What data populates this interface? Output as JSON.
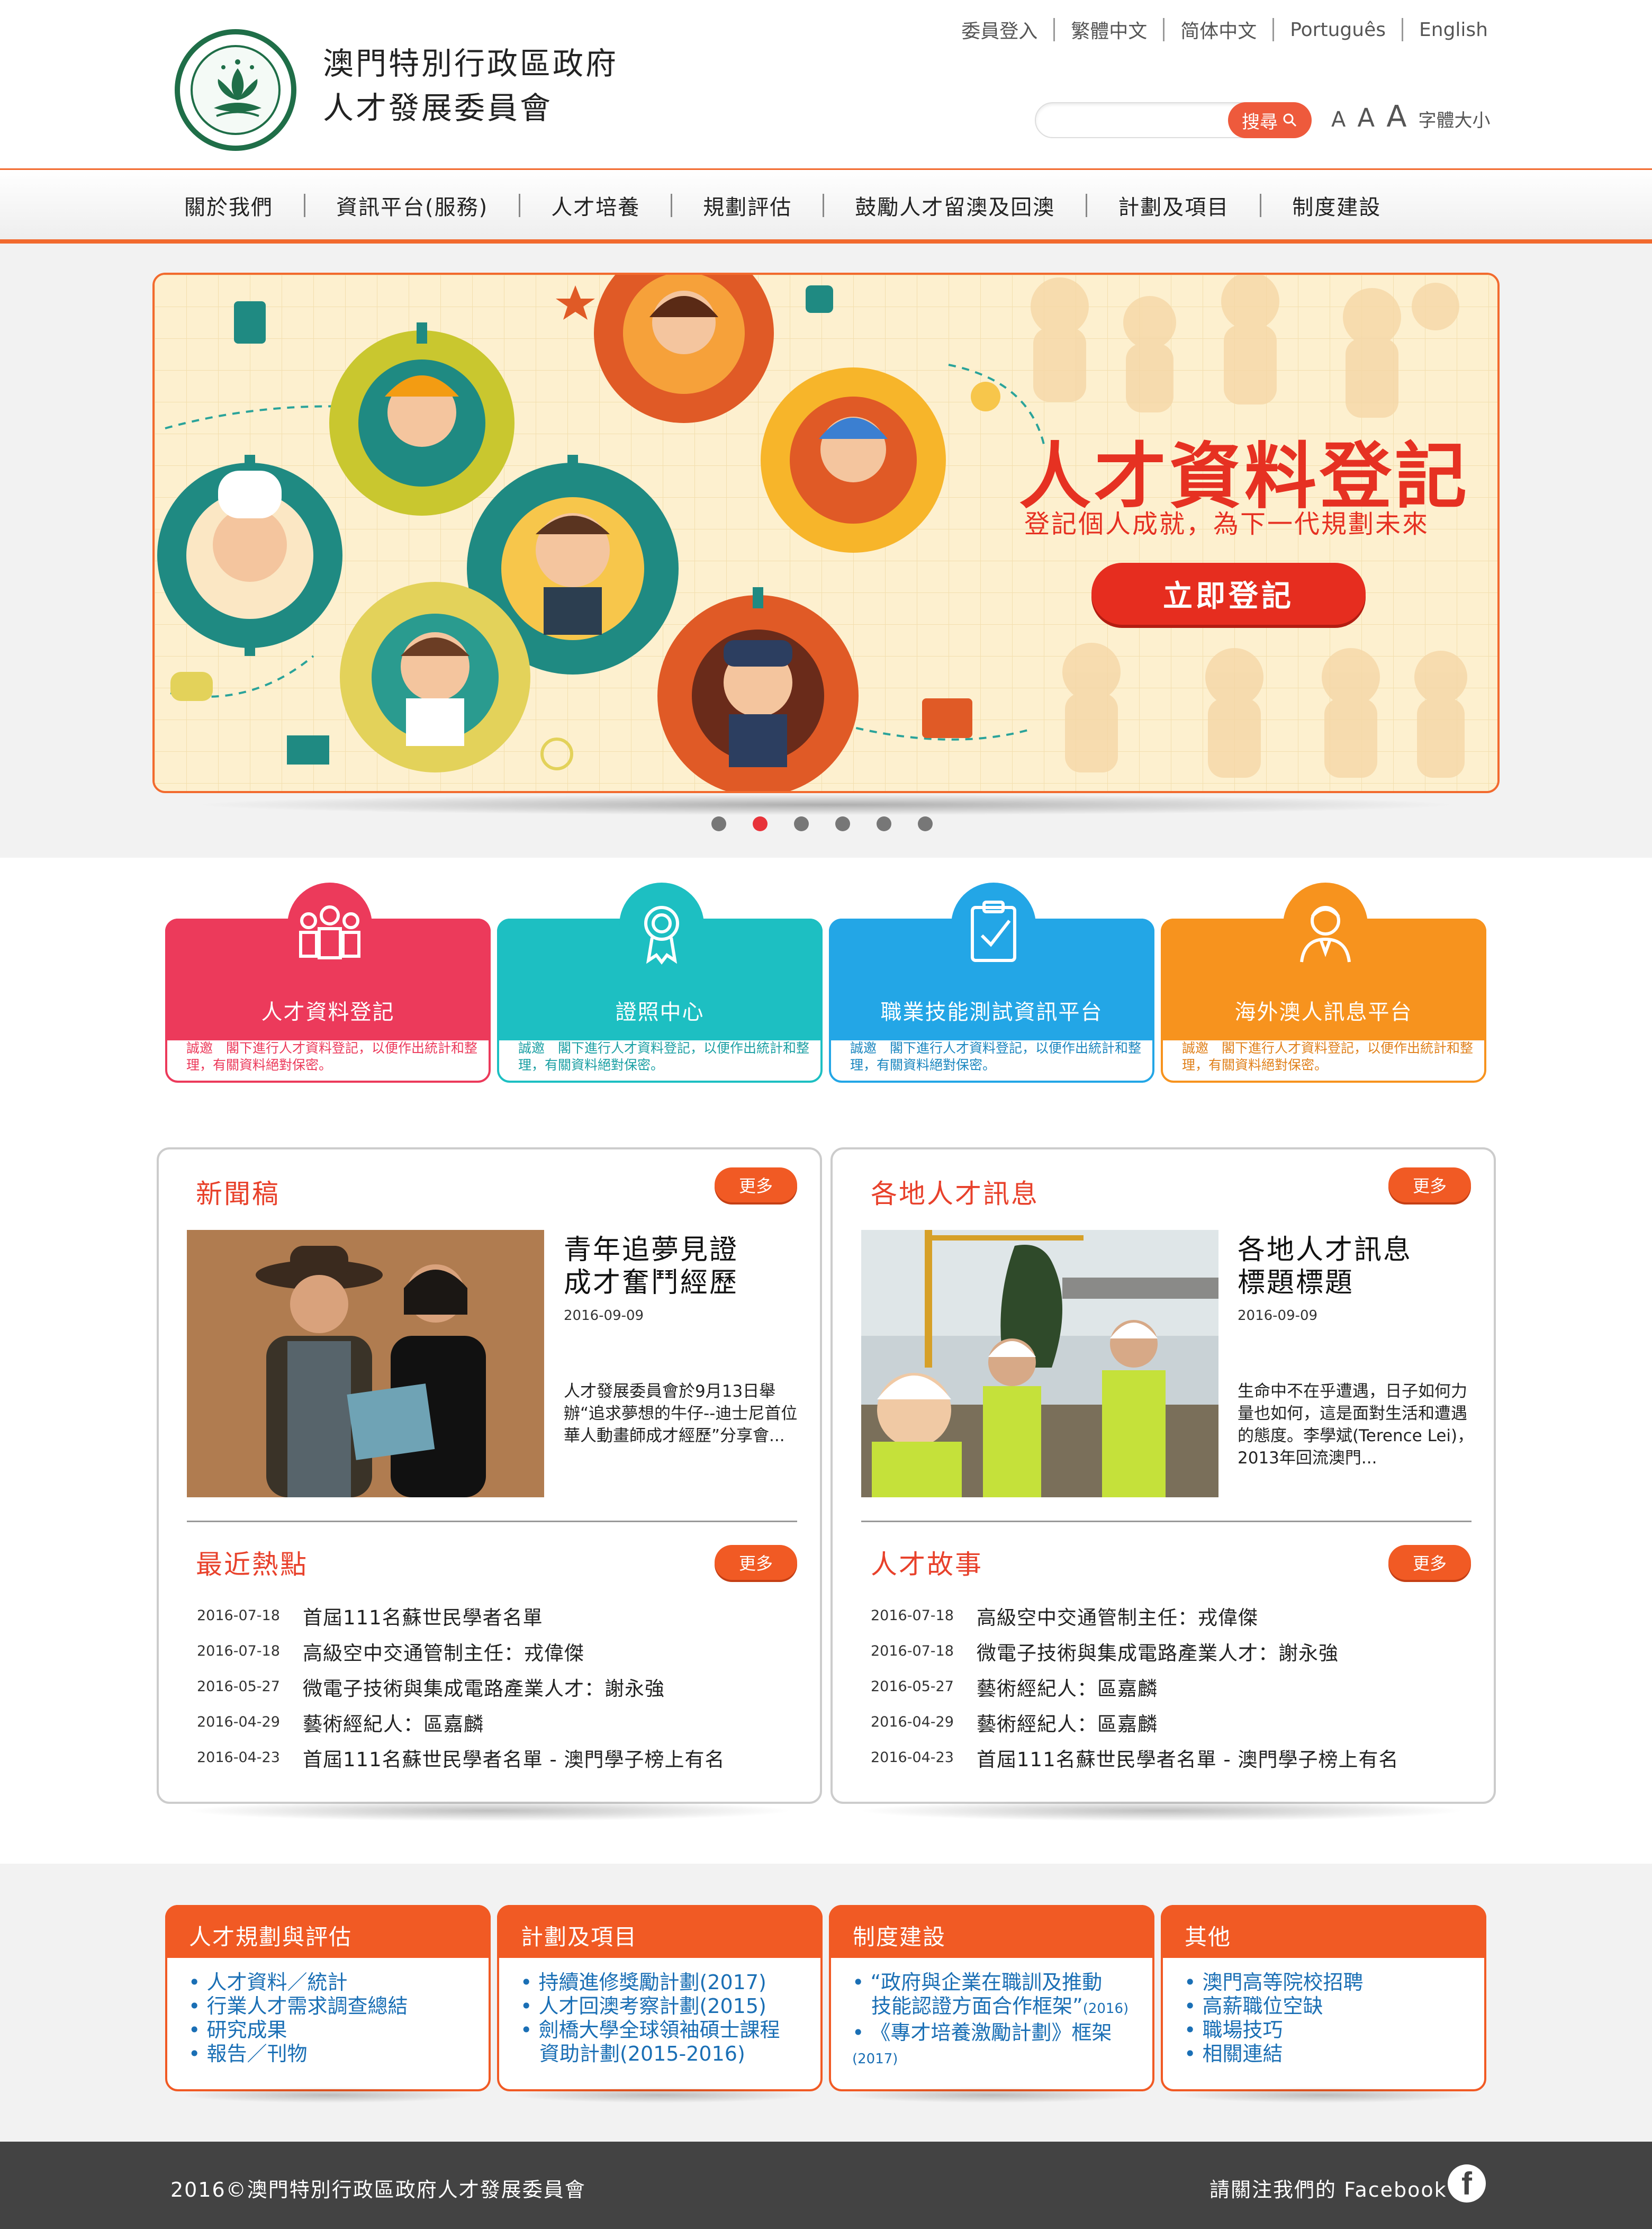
{
  "header": {
    "title_line1": "澳門特別行政區政府",
    "title_line2": "人才發展委員會",
    "top_links": [
      "委員登入",
      "繁體中文",
      "简体中文",
      "Português",
      "English"
    ],
    "search": {
      "button_label": "搜尋",
      "placeholder": ""
    },
    "font_size": {
      "small": "A",
      "medium": "A",
      "large": "A",
      "label": "字體大小"
    }
  },
  "nav": {
    "items": [
      "關於我們",
      "資訊平台(服務)",
      "人才培養",
      "規劃評估",
      "鼓勵人才留澳及回澳",
      "計劃及項目",
      "制度建設"
    ]
  },
  "banner": {
    "title": "人才資料登記",
    "subtitle": "登記個人成就，為下一代規劃未來",
    "button_label": "立即登記",
    "slide_count": 6,
    "active_slide": 2
  },
  "feature_cards": [
    {
      "label": "人才資料登記",
      "desc": "誠邀　閣下進行人才資料登記，以便作出統計和整理，有關資料絕對保密。",
      "color": "#ec3a5b",
      "icon": "people-icon"
    },
    {
      "label": "證照中心",
      "desc": "誠邀　閣下進行人才資料登記，以便作出統計和整理，有關資料絕對保密。",
      "color": "#1dbfc2",
      "icon": "certificate-icon"
    },
    {
      "label": "職業技能測試資訊平台",
      "desc": "誠邀　閣下進行人才資料登記，以便作出統計和整理，有關資料絕對保密。",
      "color": "#23a6e6",
      "icon": "clipboard-check-icon"
    },
    {
      "label": "海外澳人訊息平台",
      "desc": "誠邀　閣下進行人才資料登記，以便作出統計和整理，有關資料絕對保密。",
      "color": "#f7931e",
      "icon": "person-icon"
    }
  ],
  "news": {
    "title": "新聞稿",
    "more": "更多",
    "article": {
      "title_line1": "青年追夢見證",
      "title_line2": "成才奮鬥經歷",
      "date": "2016-09-09",
      "body": "人才發展委員會於9月13日舉辦“追求夢想的牛仔--迪士尼首位華人動畫師成才經歷”分享會..."
    }
  },
  "talent_info": {
    "title": "各地人才訊息",
    "more": "更多",
    "article": {
      "title_line1": "各地人才訊息",
      "title_line2": "標題標題",
      "date": "2016-09-09",
      "body": "生命中不在乎遭遇，日子如何力量也如何，這是面對生活和遭遇的態度。李學斌(Terence Lei)，2013年回流澳門..."
    }
  },
  "hot_topics": {
    "title": "最近熱點",
    "more": "更多",
    "items": [
      {
        "date": "2016-07-18",
        "text": "首屆111名蘇世民學者名單"
      },
      {
        "date": "2016-07-18",
        "text": "高級空中交通管制主任：戎偉傑"
      },
      {
        "date": "2016-05-27",
        "text": "微電子技術與集成電路產業人才：謝永強"
      },
      {
        "date": "2016-04-29",
        "text": "藝術經紀人：區嘉麟"
      },
      {
        "date": "2016-04-23",
        "text": "首屆111名蘇世民學者名單 - 澳門學子榜上有名"
      }
    ]
  },
  "talent_stories": {
    "title": "人才故事",
    "more": "更多",
    "items": [
      {
        "date": "2016-07-18",
        "text": "高級空中交通管制主任：戎偉傑"
      },
      {
        "date": "2016-07-18",
        "text": "微電子技術與集成電路產業人才：謝永強"
      },
      {
        "date": "2016-05-27",
        "text": "藝術經紀人：區嘉麟"
      },
      {
        "date": "2016-04-29",
        "text": "藝術經紀人：區嘉麟"
      },
      {
        "date": "2016-04-23",
        "text": "首屆111名蘇世民學者名單 - 澳門學子榜上有名"
      }
    ]
  },
  "link_boxes": [
    {
      "title": "人才規劃與評估",
      "items": [
        "人才資料／統計",
        "行業人才需求調查總結",
        "研究成果",
        "報告／刊物"
      ]
    },
    {
      "title": "計劃及項目",
      "items": [
        "持續進修獎勵計劃(2017)",
        "人才回澳考察計劃(2015)",
        "劍橋大學全球領袖碩士課程",
        "資助計劃(2015-2016)"
      ]
    },
    {
      "title": "制度建設",
      "items": [
        "“政府與企業在職訓及推動",
        "技能認證方面合作框架”",
        "(2016)",
        "《專才培養激勵計劃》框架",
        "(2017)"
      ]
    },
    {
      "title": "其他",
      "items": [
        "澳門高等院校招聘",
        "高薪職位空缺",
        "職場技巧",
        "相關連結"
      ]
    }
  ],
  "footer": {
    "copyright": "2016©澳門特別行政區政府人才發展委員會",
    "follow": "請關注我們的 Facebook",
    "fb_glyph": "f"
  },
  "colors": {
    "accent": "#f15a24",
    "red": "#e63122",
    "nav_border": "#f26a2e",
    "link": "#1a6fb5",
    "footer": "#434343"
  }
}
